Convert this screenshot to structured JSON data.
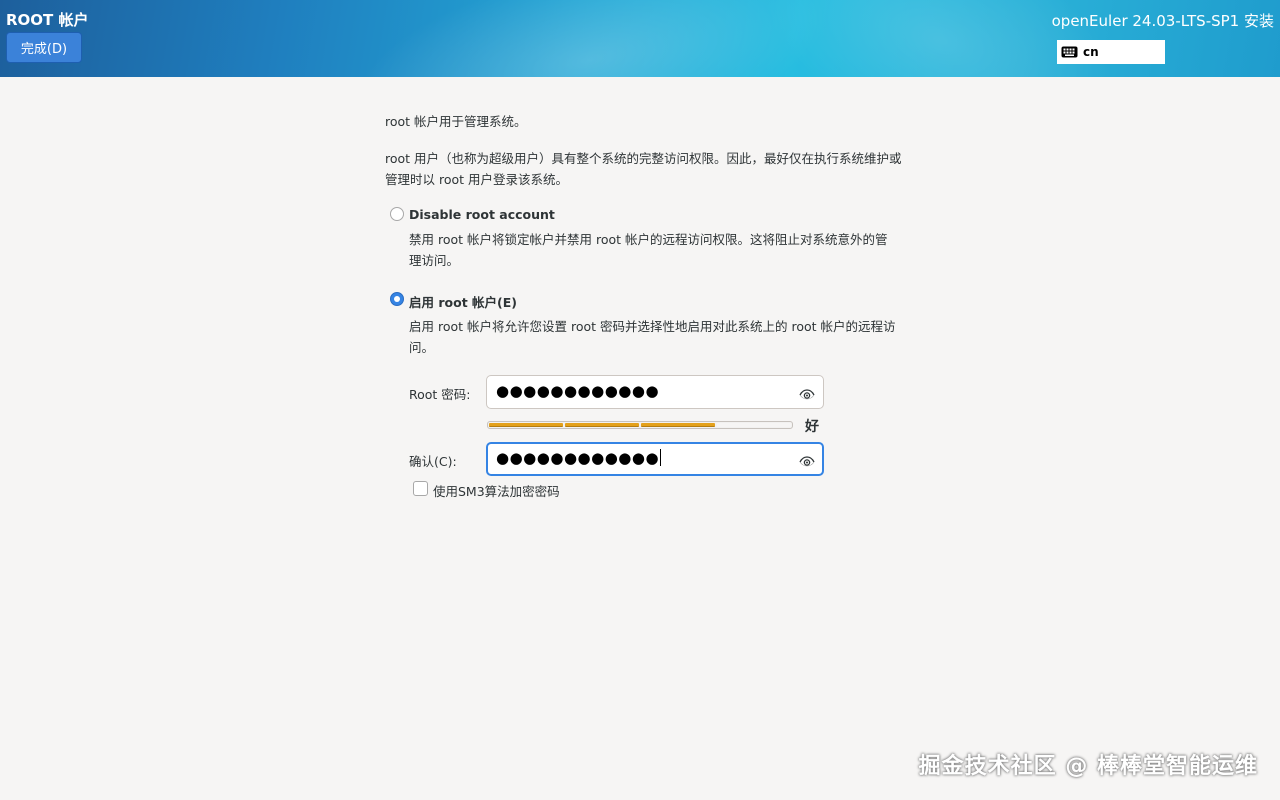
{
  "header": {
    "title": "ROOT 帐户",
    "done_label": "完成(D)",
    "product": "openEuler 24.03-LTS-SP1 安装",
    "keyboard_layout": "cn"
  },
  "intro": {
    "line1": "root 帐户用于管理系统。",
    "line2": "root 用户（也称为超级用户）具有整个系统的完整访问权限。因此，最好仅在执行系统维护或管理时以 root 用户登录该系统。"
  },
  "options": {
    "disable": {
      "label": "Disable root account",
      "description": "禁用 root 帐户将锁定帐户并禁用 root 帐户的远程访问权限。这将阻止对系统意外的管理访问。",
      "selected": false
    },
    "enable": {
      "label": "启用 root 帐户(E)",
      "description": "启用 root 帐户将允许您设置 root 密码并选择性地启用对此系统上的 root 帐户的远程访问。",
      "selected": true
    }
  },
  "password": {
    "label": "Root 密码:",
    "masked_value": "●●●●●●●●●●●●",
    "strength_label": "好",
    "strength_fraction": 0.75
  },
  "confirm": {
    "label": "确认(C):",
    "masked_value": "●●●●●●●●●●●●"
  },
  "sm3": {
    "label": "使用SM3算法加密密码",
    "checked": false
  },
  "watermark": "掘金技术社区 @ 棒棒堂智能运维",
  "colors": {
    "accent": "#3584e4",
    "strength_fill": "#e4a11b"
  }
}
